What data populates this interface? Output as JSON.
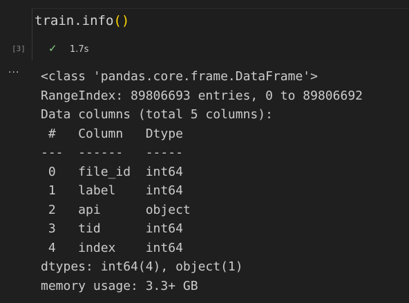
{
  "cell": {
    "execution_count": "[3]",
    "code": {
      "prefix": "train.info",
      "parens": "()"
    },
    "status_icon": "check-icon",
    "status_check": "✓",
    "duration": "1.7s"
  },
  "output": {
    "menu_glyph": "...",
    "lines": [
      "<class 'pandas.core.frame.DataFrame'>",
      "RangeIndex: 89806693 entries, 0 to 89806692",
      "Data columns (total 5 columns):",
      " #   Column   Dtype",
      "---  ------   -----",
      " 0   file_id  int64",
      " 1   label    int64",
      " 2   api      object",
      " 3   tid      int64",
      " 4   index    int64",
      "dtypes: int64(4), object(1)",
      "memory usage: 3.3+ GB"
    ]
  },
  "colors": {
    "background": "#1f1f1f",
    "text": "#cccccc",
    "paren": "#ffd700",
    "success": "#89d185"
  }
}
